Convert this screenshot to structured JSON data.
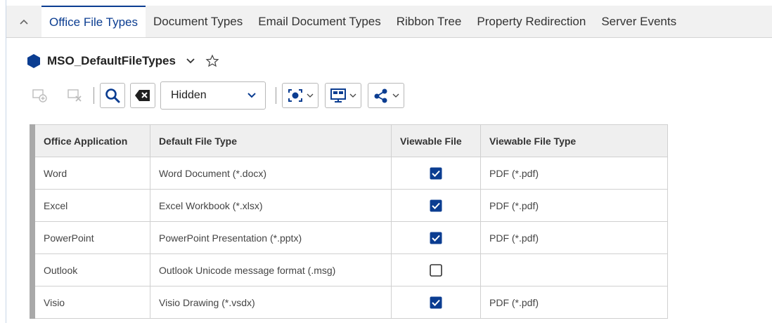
{
  "tabs": [
    {
      "label": "Office File Types",
      "active": true
    },
    {
      "label": "Document Types",
      "active": false
    },
    {
      "label": "Email Document Types",
      "active": false
    },
    {
      "label": "Ribbon Tree",
      "active": false
    },
    {
      "label": "Property Redirection",
      "active": false
    },
    {
      "label": "Server Events",
      "active": false
    }
  ],
  "header": {
    "title": "MSO_DefaultFileTypes"
  },
  "toolbar": {
    "visibility_select": "Hidden"
  },
  "grid": {
    "columns": [
      "Office Application",
      "Default File Type",
      "Viewable File",
      "Viewable File Type"
    ],
    "rows": [
      {
        "app": "Word",
        "default_type": "Word Document (*.docx)",
        "viewable": true,
        "viewable_type": "PDF (*.pdf)"
      },
      {
        "app": "Excel",
        "default_type": "Excel Workbook (*.xlsx)",
        "viewable": true,
        "viewable_type": "PDF (*.pdf)"
      },
      {
        "app": "PowerPoint",
        "default_type": "PowerPoint Presentation (*.pptx)",
        "viewable": true,
        "viewable_type": "PDF (*.pdf)"
      },
      {
        "app": "Outlook",
        "default_type": "Outlook Unicode message format (.msg)",
        "viewable": false,
        "viewable_type": ""
      },
      {
        "app": "Visio",
        "default_type": "Visio Drawing (*.vsdx)",
        "viewable": true,
        "viewable_type": "PDF (*.pdf)"
      }
    ]
  },
  "colors": {
    "accent": "#0b3d91",
    "checkbox": "#0b3d91"
  }
}
